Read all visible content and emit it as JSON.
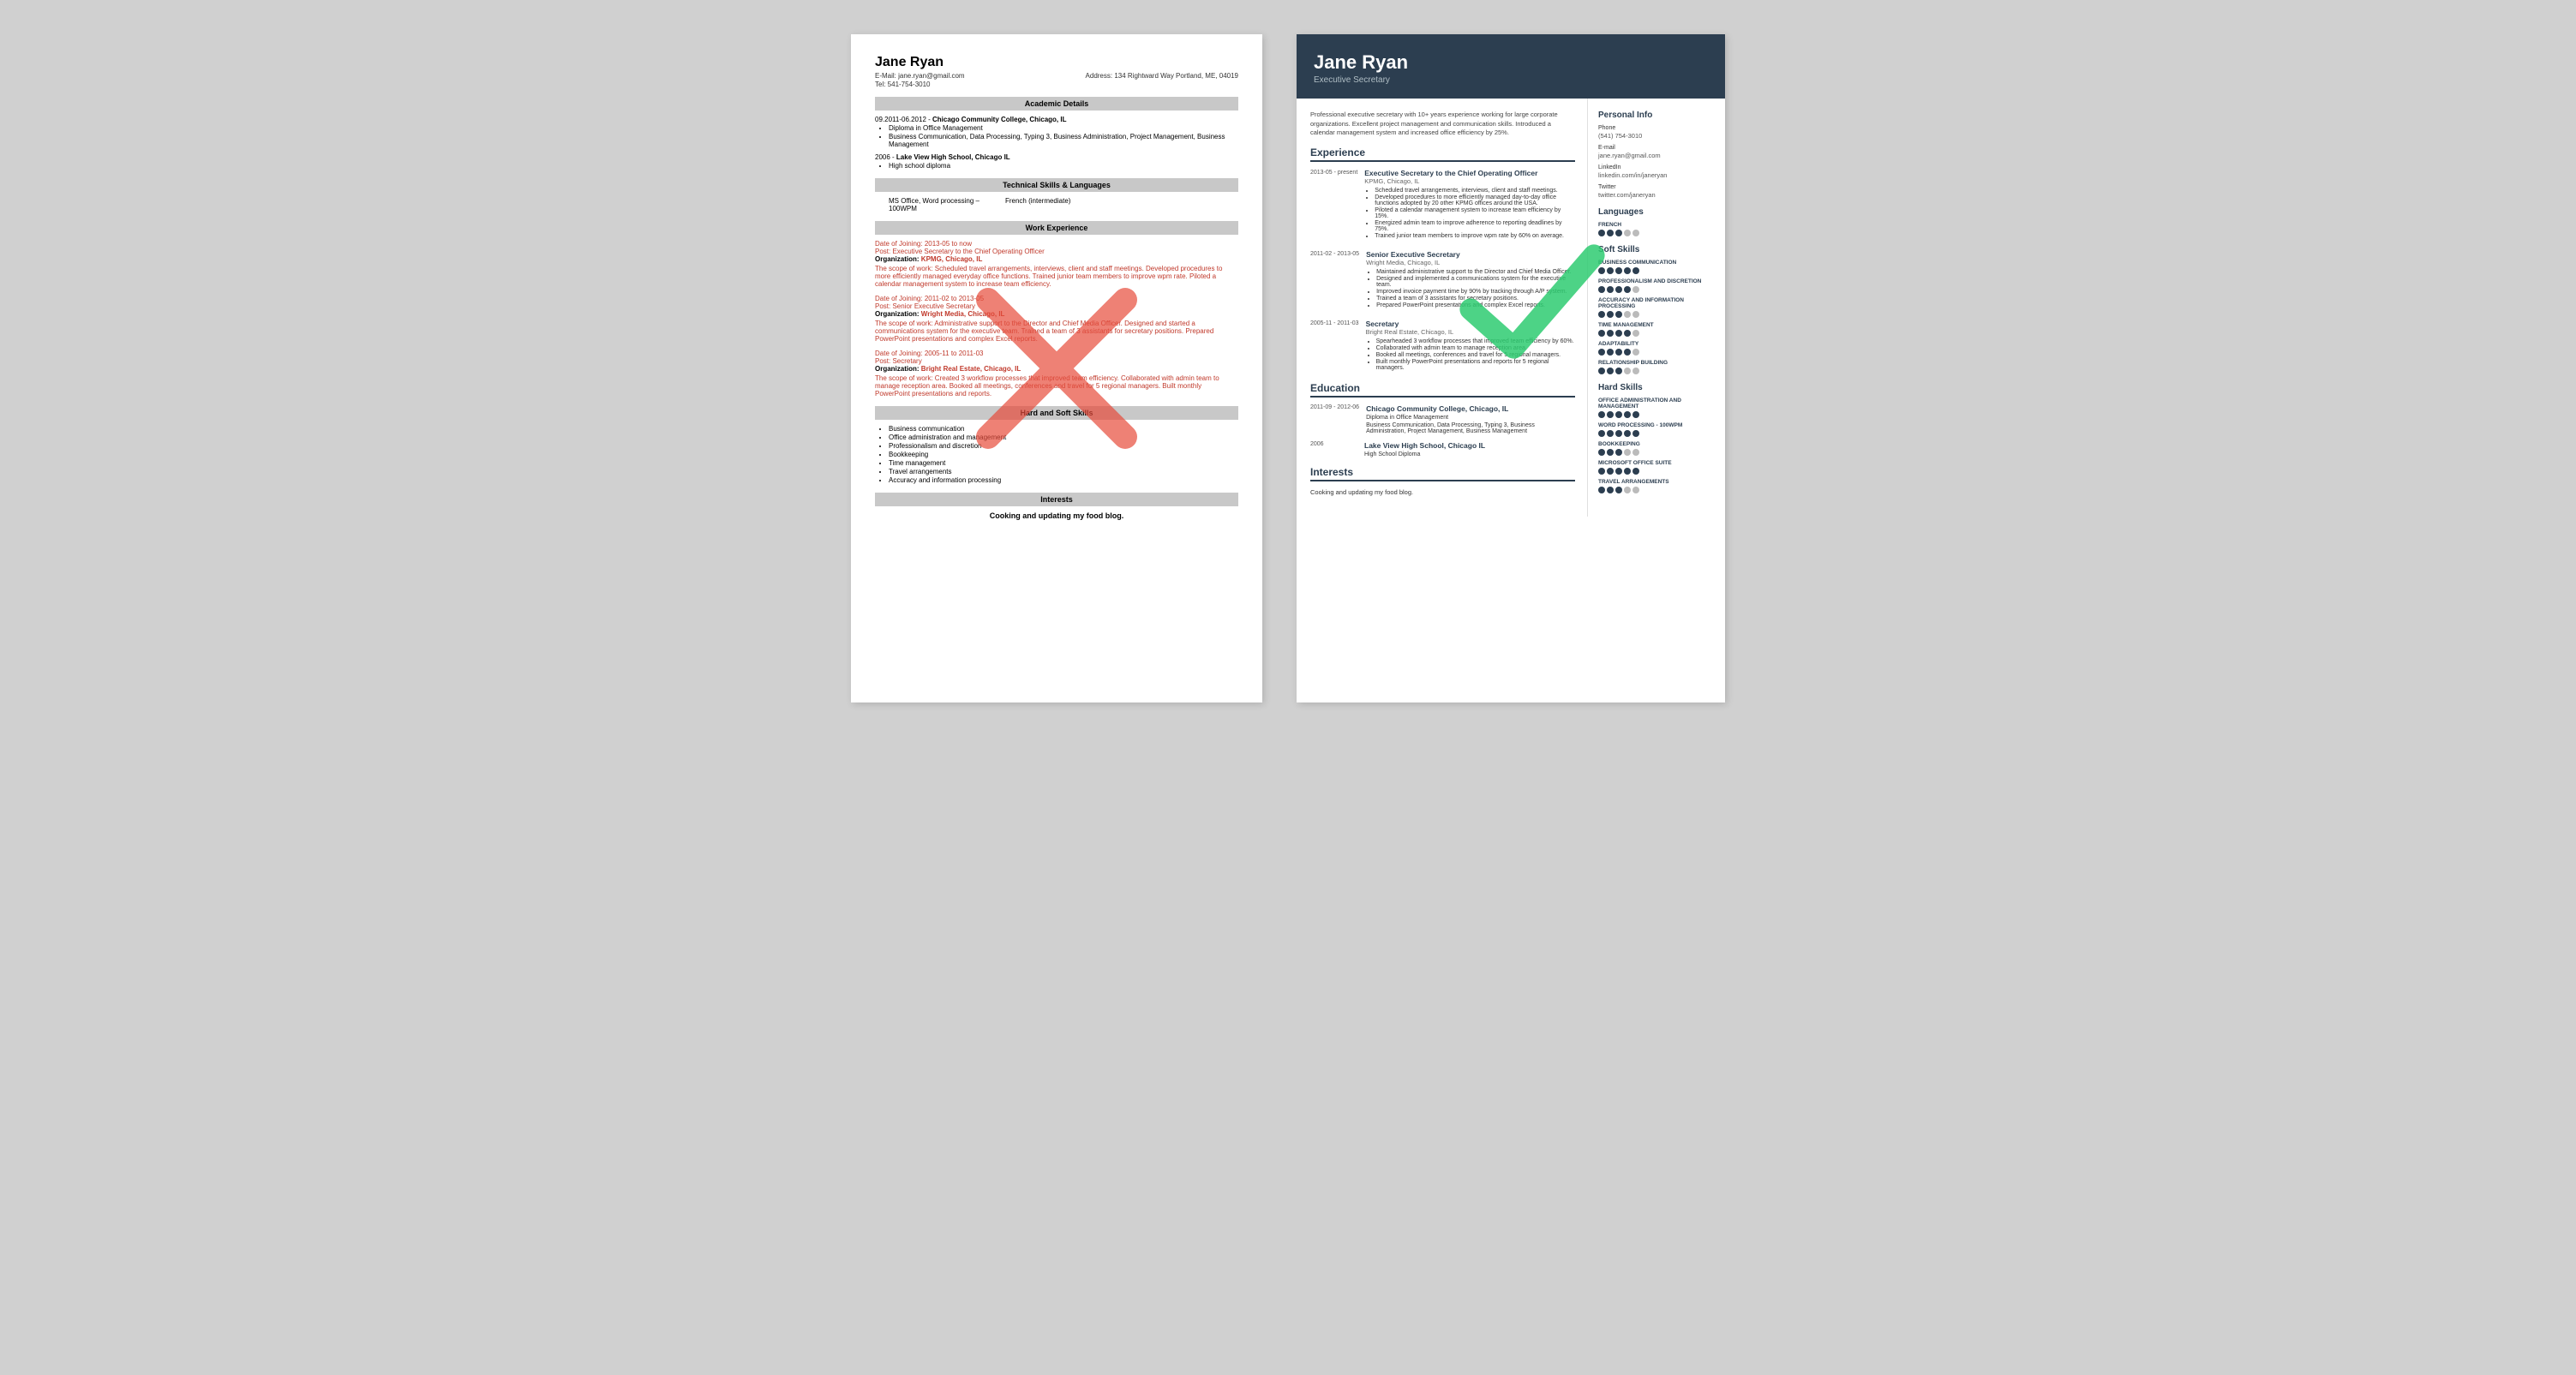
{
  "left_resume": {
    "name": "Jane Ryan",
    "email": "E-Mail: jane.ryan@gmail.com",
    "tel": "Tel: 541-754-3010",
    "address": "Address: 134 Rightward Way Portland, ME, 04019",
    "sections": {
      "academic": "Academic Details",
      "technical": "Technical Skills & Languages",
      "work": "Work Experience",
      "skills": "Hard and Soft Skills",
      "interests": "Interests"
    },
    "education": [
      {
        "date": "09.2011-06.2012",
        "school": "Chicago Community College, Chicago, IL",
        "items": [
          "Diploma in Office Management",
          "Business Communication, Data Processing, Typing 3, Business Administration, Project Management, Business Management"
        ]
      },
      {
        "date": "2006",
        "school": "Lake View High School, Chicago IL",
        "items": [
          "High school diploma"
        ]
      }
    ],
    "technical_skills": "MS Office, Word processing –",
    "languages": "French (intermediate)",
    "typing": "100WPM",
    "work_experience": [
      {
        "date_label": "Date of Joining:",
        "date": "2013-05 to now",
        "post_label": "Post:",
        "post": "Executive Secretary to the Chief Operating Officer",
        "org_label": "Organization:",
        "org": "KPMG, Chicago, IL",
        "desc": "The scope of work: Scheduled travel arrangements, interviews, client and staff meetings. Developed procedures to more efficiently managed everyday office functions. Trained junior team members to improve wpm rate. Piloted a calendar management system to increase team efficiency."
      },
      {
        "date_label": "Date of Joining:",
        "date": "2011-02 to 2013-05",
        "post_label": "Post:",
        "post": "Senior Executive Secretary",
        "org_label": "Organization:",
        "org": "Wright Media, Chicago, IL",
        "desc": "The scope of work: Administrative support to the Director and Chief Media Officer. Designed and started a communications system for the executive team. Trained a team of 3 assistants for secretary positions. Prepared PowerPoint presentations and complex Excel reports."
      },
      {
        "date_label": "Date of Joining:",
        "date": "2005-11 to 2011-03",
        "post_label": "Post:",
        "post": "Secretary",
        "org_label": "Organization:",
        "org": "Bright Real Estate, Chicago, IL",
        "desc": "The scope of work: Created 3 workflow processes that improved team efficiency. Collaborated with admin team to manage reception area. Booked all meetings, conferences and travel for 5 regional managers. Built monthly PowerPoint presentations and reports."
      }
    ],
    "hard_soft_skills": [
      "Business communication",
      "Office administration and management",
      "Professionalism and discretion",
      "Bookkeeping",
      "Time management",
      "Travel arrangements",
      "Accuracy and information processing"
    ],
    "interests_text": "Cooking and updating my food blog."
  },
  "right_resume": {
    "name": "Jane Ryan",
    "title": "Executive Secretary",
    "summary": "Professional executive secretary with 10+ years experience working for large corporate organizations. Excellent project management and communication skills. Introduced a calendar management system and increased office efficiency by 25%.",
    "sections": {
      "experience": "Experience",
      "education": "Education",
      "interests": "Interests"
    },
    "experience": [
      {
        "date": "2013-05 - present",
        "job_title": "Executive Secretary to the Chief Operating Officer",
        "company": "KPMG, Chicago, IL",
        "bullets": [
          "Scheduled travel arrangements, interviews, client and staff meetings.",
          "Developed procedures to more efficiently managed day-to-day office functions adopted by 20 other KPMG offices around the USA.",
          "Piloted a calendar management system to increase team efficiency by 15%.",
          "Energized admin team to improve adherence to reporting deadlines by 75%.",
          "Trained junior team members to improve wpm rate by 60% on average."
        ]
      },
      {
        "date": "2011-02 - 2013-05",
        "job_title": "Senior Executive Secretary",
        "company": "Wright Media, Chicago, IL",
        "bullets": [
          "Maintained administrative support to the Director and Chief Media Officer.",
          "Designed and implemented a communications system for the executive team.",
          "Improved invoice payment time by 90% by tracking through A/P system.",
          "Trained a team of 3 assistants for secretary positions.",
          "Prepared PowerPoint presentations and complex Excel reports."
        ]
      },
      {
        "date": "2005-11 - 2011-03",
        "job_title": "Secretary",
        "company": "Bright Real Estate, Chicago, IL",
        "bullets": [
          "Spearheaded 3 workflow processes that improved team efficiency by 60%.",
          "Collaborated with admin team to manage reception area.",
          "Booked all meetings, conferences and travel for 5 regional managers.",
          "Built monthly PowerPoint presentations and reports for 5 regional managers."
        ]
      }
    ],
    "education": [
      {
        "date": "2011-09 - 2012-06",
        "school": "Chicago Community College, Chicago, IL",
        "degree": "Diploma in Office Management",
        "extra": "Business Communication, Data Processing, Typing 3, Business Administration, Project Management, Business Management"
      },
      {
        "date": "2006",
        "school": "Lake View High School, Chicago IL",
        "degree": "High School Diploma"
      }
    ],
    "interests_text": "Cooking and updating my food blog.",
    "personal_info": {
      "section_title": "Personal Info",
      "phone_label": "Phone",
      "phone": "(541) 754-3010",
      "email_label": "E-mail",
      "email": "jane.ryan@gmail.com",
      "linkedin_label": "LinkedIn",
      "linkedin": "linkedin.com/in/janeryan",
      "twitter_label": "Twitter",
      "twitter": "twitter.com/janeryan"
    },
    "languages": {
      "section_title": "Languages",
      "name": "French",
      "dots": [
        1,
        1,
        1,
        0,
        0
      ]
    },
    "soft_skills": {
      "section_title": "Soft Skills",
      "items": [
        {
          "name": "BUSINESS COMMUNICATION",
          "dots": [
            1,
            1,
            1,
            1,
            1
          ]
        },
        {
          "name": "PROFESSIONALISM AND DISCRETION",
          "dots": [
            1,
            1,
            1,
            1,
            0
          ]
        },
        {
          "name": "ACCURACY AND INFORMATION PROCESSING",
          "dots": [
            1,
            1,
            1,
            0,
            0
          ]
        },
        {
          "name": "TIME MANAGEMENT",
          "dots": [
            1,
            1,
            1,
            1,
            0
          ]
        },
        {
          "name": "ADAPTABILITY",
          "dots": [
            1,
            1,
            1,
            1,
            0
          ]
        },
        {
          "name": "RELATIONSHIP BUILDING",
          "dots": [
            1,
            1,
            1,
            0,
            0
          ]
        }
      ]
    },
    "hard_skills": {
      "section_title": "Hard Skills",
      "items": [
        {
          "name": "OFFICE ADMINISTRATION AND MANAGEMENT",
          "dots": [
            1,
            1,
            1,
            1,
            1
          ]
        },
        {
          "name": "WORD PROCESSING - 100WPM",
          "dots": [
            1,
            1,
            1,
            1,
            1
          ]
        },
        {
          "name": "BOOKKEEPING",
          "dots": [
            1,
            1,
            1,
            0,
            0
          ]
        },
        {
          "name": "MICROSOFT OFFICE SUITE",
          "dots": [
            1,
            1,
            1,
            1,
            1
          ]
        },
        {
          "name": "TRAVEL ARRANGEMENTS",
          "dots": [
            1,
            1,
            1,
            0,
            0
          ]
        }
      ]
    }
  }
}
